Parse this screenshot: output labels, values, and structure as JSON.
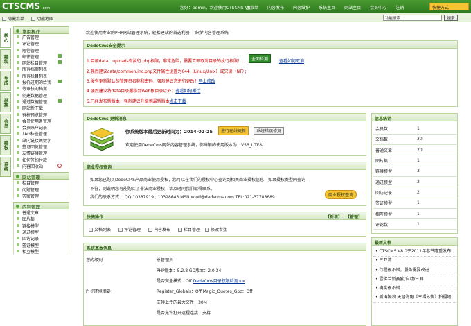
{
  "brand": {
    "logo": "CTSCMS",
    "logo_sub": ".com"
  },
  "top": {
    "welcome": "您好：admin，欢迎使用CTSCMS V8!",
    "nav": [
      "主菜单",
      "内容发布",
      "内容维护",
      "系统主页",
      "网站主页",
      "会员中心",
      "注销"
    ],
    "quick": "快捷方式"
  },
  "bar2": {
    "hide_menu": "隐藏菜单",
    "func_map": "功能地图",
    "search_placeholder": "功能搜索",
    "search_btn": "搜索"
  },
  "tabs": [
    "核心",
    "模块",
    "生成",
    "采集",
    "会员",
    "模板",
    "系统"
  ],
  "menu": {
    "g1_title": "常用操作",
    "g1": [
      "广告管理",
      "评论管理",
      "短信管理",
      "邮件管理",
      "网站栏目管理",
      "所有档案列表",
      "所有栏目列表",
      "报价过期的给我",
      "等审核的档案",
      "创建数据管理",
      "通过数据管理",
      "网站新下载",
      "有标预览管理",
      "会员使用条管理",
      "会员账户记录",
      "TAG标签管理",
      "站内链接关键字",
      "签证回复管理",
      "友情链接管理",
      "如何签约付款",
      "内容回收站"
    ],
    "g2_title": "网站管理",
    "g2": [
      "栏目管理",
      "问题管理",
      "答案管理"
    ],
    "g3_title": "内容管理",
    "g3": [
      "普通文章",
      "图片集",
      "链接模型",
      "通过模型",
      "回访记录",
      "签证模型",
      "相互模型"
    ]
  },
  "welcome_line": "欢迎使用专业的PHP网站管理系统，轻松建站的首选利器 -- 织梦内容管理系统",
  "security": {
    "title": "DedeCms安全提示",
    "lines": [
      "1.目前data、uploads有执行.php权限，非常危险，需要立即取消目录的执行权限！",
      "2.强烈建议data/common.inc.php文件属性设置为644（Linux/Unix）或只读（NT）；",
      "3.後有更新默认的管理员名称和密码，强烈建议您进行更改！",
      "4.强烈建议将data目录搬移到Web根目录以外；",
      "5.已经发布新版本，强烈建议升级到最新版本"
    ],
    "check_btn": "全面检测",
    "cancel_link": "查看如何取消",
    "l3_link": "马上修改",
    "l4_link": "查看如何搬迁",
    "l5_link": "点击下载"
  },
  "update": {
    "title": "DedeCms 更新消息",
    "line1": "你系统版本最后更新时间为：2014-02-25",
    "btn_check": "进行在线更新",
    "btn_fix": "系统错误修复",
    "line2": "欢迎使用DedeCms网站内容管理系统，你当前的使用版本为：V56_UTF8。"
  },
  "license": {
    "title": "商业授权查询",
    "text1": "如果您已购买DedeCMS产品商业使用授权，您可以在我们的授权中心查询到相关商业授权信息，如果授权类型同查询",
    "text2": "不符，则说明您可能购买了非法商业授权，请及时同我们取得联系。",
    "text3": "我们的联系方式：  QQ:10387919 ; 10328643 MSN:wind@dedecms.com TEL:021-37788689",
    "btn": "商业授权查询"
  },
  "shortcut": {
    "title": "快捷操作",
    "new": "【新增】",
    "manage": "【管理】",
    "items": [
      "文档列表",
      "评论管理",
      "内容发布",
      "栏目管理",
      "修改参数"
    ]
  },
  "sysinfo": {
    "title": "系统基本信息",
    "k1": "您的级别：",
    "v1": "总管理员",
    "k2": "PHP环境摘要：",
    "r1": "PHP版本：5.2.8   GD版本：2.0.34",
    "r2": "是否安全模式：Off",
    "r2_link": "DedeCms目录权限检测>>",
    "r3": "Register_Globals：Off   Magic_Quotes_Gpc：Off",
    "r4": "支持上传的最大文件：30M",
    "r5": "是否允许打开远程连接：支持"
  },
  "stats": {
    "title": "信息统计",
    "rows": [
      [
        "会员数：",
        "1"
      ],
      [
        "文档数：",
        "30"
      ],
      [
        "普通文章：",
        "20"
      ],
      [
        "图片集：",
        "1"
      ],
      [
        "链接模型：",
        "3"
      ],
      [
        "通过模型：",
        "2"
      ],
      [
        "回访记录：",
        "2"
      ],
      [
        "签证模型：",
        "1"
      ],
      [
        "相互模型：",
        "1"
      ],
      [
        "评论数：",
        "1"
      ]
    ]
  },
  "news": {
    "title": "最新文档",
    "items": [
      "• CTSCMS V8.0于2011年春节隆重发布",
      "• 三亚湾",
      "• 行程很不错，服务需要改进",
      "• 雪佛兰新赛欧/自动/三厢",
      "• 确实很不错",
      "• 听涛隔浪  天涯海角《幸福苏悦》拍摄地"
    ]
  }
}
